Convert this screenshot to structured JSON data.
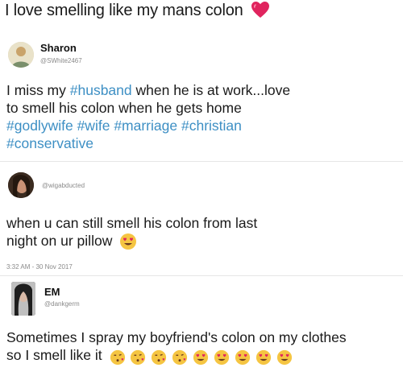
{
  "caption": {
    "text": "I love smelling like my mans colon",
    "emoji": "heart-emoji"
  },
  "tweet1": {
    "name": "Sharon",
    "handle": "@SWhite2467",
    "text_parts": [
      "I miss my ",
      "#husband",
      " when he is at work...love",
      "to smell his colon when he gets home",
      "#godlywife",
      " ",
      "#wife",
      " ",
      "#marriage",
      " ",
      "#christian",
      "#conservative"
    ]
  },
  "tweet2": {
    "handle": "@wigabducted",
    "lines": [
      "when u can still smell his colon from last",
      "night on ur pillow"
    ],
    "emoji": "heart-eyes-emoji",
    "meta": "3:32 AM - 30 Nov 2017"
  },
  "tweet3": {
    "name": "EM",
    "handle": "@dankgerm",
    "lines": [
      "Sometimes I spray my boyfriend's colon on my clothes",
      "so I smell like it"
    ],
    "emojis": [
      "kissing-heart-emoji",
      "kissing-heart-emoji",
      "kissing-heart-emoji",
      "kissing-heart-emoji",
      "heart-eyes-emoji",
      "heart-eyes-emoji",
      "heart-eyes-emoji",
      "heart-eyes-emoji",
      "heart-eyes-emoji"
    ]
  },
  "colors": {
    "hashtag": "#3d8fc4",
    "heart": "#e0245e",
    "face": "#f5c542"
  }
}
